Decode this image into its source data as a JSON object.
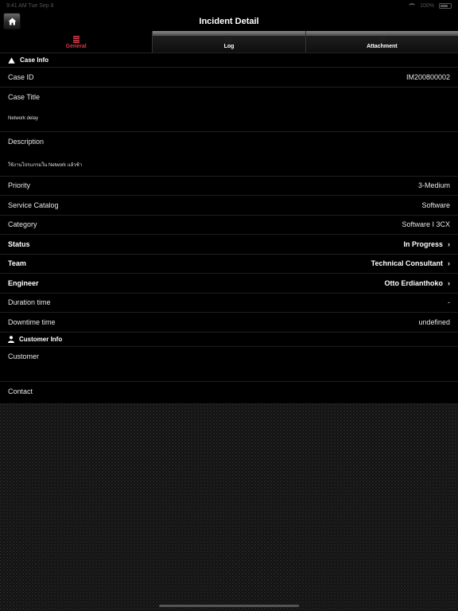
{
  "status_bar": {
    "time": "9:41 AM  Tue Sep 8",
    "signal": "100%"
  },
  "navbar": {
    "title": "Incident Detail",
    "home_icon": "home-icon"
  },
  "tabs": [
    {
      "label": "General",
      "icon": "list-icon",
      "active": true
    },
    {
      "label": "Log",
      "icon": "clock-icon",
      "active": false
    },
    {
      "label": "Attachment",
      "icon": "paperclip-icon",
      "active": false
    }
  ],
  "case_info": {
    "header": "Case Info",
    "case_id": {
      "label": "Case ID",
      "value": "IM200800002"
    },
    "case_title": {
      "label": "Case Title",
      "value": "Network delay"
    },
    "description": {
      "label": "Description",
      "value": "ใช้งานโปรแกรมใน Network แล้วช้า"
    },
    "priority": {
      "label": "Priority",
      "value": "3-Medium"
    },
    "service_catalog": {
      "label": "Service Catalog",
      "value": "Software"
    },
    "category": {
      "label": "Category",
      "value": "Software I 3CX"
    },
    "status": {
      "label": "Status",
      "value": "In Progress"
    },
    "team": {
      "label": "Team",
      "value": "Technical Consultant"
    },
    "engineer": {
      "label": "Engineer",
      "value": "Otto Erdianthoko"
    },
    "duration_time": {
      "label": "Duration time",
      "value": "-"
    },
    "downtime_time": {
      "label": "Downtime time",
      "value": "undefined"
    }
  },
  "customer_info": {
    "header": "Customer Info",
    "customer": {
      "label": "Customer"
    },
    "contact": {
      "label": "Contact"
    }
  },
  "colors": {
    "accent": "#d43a4a",
    "background": "#000000",
    "text": "#ffffff"
  }
}
